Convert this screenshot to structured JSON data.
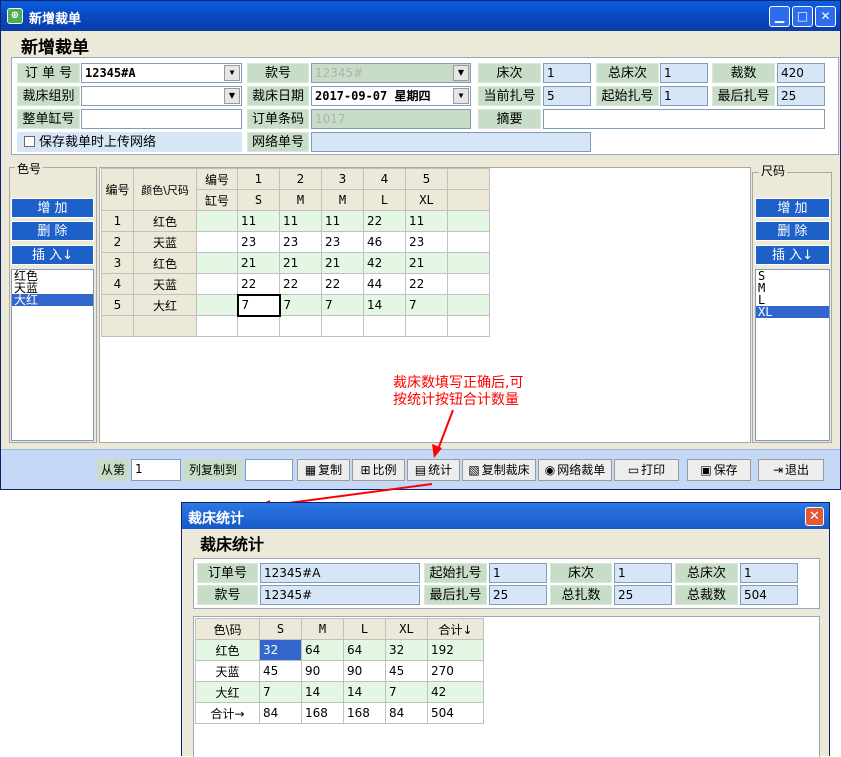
{
  "window": {
    "title": "新增裁单",
    "heading": "新增裁单"
  },
  "form": {
    "order_no_label": "订 单 号",
    "order_no": "12345#A",
    "style_no_label": "款号",
    "style_no": "12345#",
    "bed_no_label": "床次",
    "bed_no": "1",
    "total_bed_label": "总床次",
    "total_bed": "1",
    "cut_qty_label": "裁数",
    "cut_qty": "420",
    "cut_group_label": "裁床组别",
    "cut_group": "",
    "cut_date_label": "裁床日期",
    "cut_date": "2017-09-07 星期四",
    "cur_bundle_label": "当前扎号",
    "cur_bundle": "5",
    "start_bundle_label": "起始扎号",
    "start_bundle": "1",
    "last_bundle_label": "最后扎号",
    "last_bundle": "25",
    "whole_vat_label": "整单缸号",
    "whole_vat": "",
    "barcode_label": "订单条码",
    "barcode": "1017",
    "summary_label": "摘要",
    "summary": "",
    "upload_checkbox_label": "保存裁单时上传网络",
    "net_no_label": "网络单号",
    "net_no": ""
  },
  "color_group": {
    "title": "色号",
    "add": "增 加",
    "delete": "删 除",
    "insert": "插 入↓",
    "items": [
      {
        "label": "红色"
      },
      {
        "label": "天蓝"
      },
      {
        "label": "大红"
      }
    ]
  },
  "size_group": {
    "title": "尺码",
    "add": "增 加",
    "delete": "删 除",
    "insert": "插 入↓",
    "items": [
      {
        "label": "S"
      },
      {
        "label": "M"
      },
      {
        "label": "L"
      },
      {
        "label": "XL"
      }
    ]
  },
  "grid": {
    "h_no": "编号",
    "h_colorsize": "颜色\\尺码",
    "h_no2": "编号",
    "h_vat": "缸号",
    "size_nums": [
      "1",
      "2",
      "3",
      "4",
      "5"
    ],
    "sizes": [
      "S",
      "M",
      "M",
      "L",
      "XL"
    ],
    "rows": [
      {
        "no": "1",
        "color": "红色",
        "vals": [
          "11",
          "11",
          "11",
          "22",
          "11"
        ]
      },
      {
        "no": "2",
        "color": "天蓝",
        "vals": [
          "23",
          "23",
          "23",
          "46",
          "23"
        ]
      },
      {
        "no": "3",
        "color": "红色",
        "vals": [
          "21",
          "21",
          "21",
          "42",
          "21"
        ]
      },
      {
        "no": "4",
        "color": "天蓝",
        "vals": [
          "22",
          "22",
          "22",
          "44",
          "22"
        ]
      },
      {
        "no": "5",
        "color": "大红",
        "vals": [
          "7",
          "7",
          "7",
          "14",
          "7"
        ]
      }
    ]
  },
  "annotation": "裁床数填写正确后,可\n按统计按钮合计数量",
  "toolbar": {
    "from_label": "从第",
    "from_value": "1",
    "copy_col_label": "列复制到",
    "copy_col_value": "",
    "copy": "复制",
    "ratio": "比例",
    "stats": "统计",
    "copy_bed": "复制裁床",
    "net_cut": "网络裁单",
    "print": "打印",
    "save": "保存",
    "exit": "退出"
  },
  "stats_window": {
    "title": "裁床统计",
    "heading": "裁床统计",
    "order_no_label": "订单号",
    "order_no": "12345#A",
    "start_bundle_label": "起始扎号",
    "start_bundle": "1",
    "bed_label": "床次",
    "bed": "1",
    "total_bed_label": "总床次",
    "total_bed": "1",
    "style_label": "款号",
    "style": "12345#",
    "last_bundle_label": "最后扎号",
    "last_bundle": "25",
    "total_bundle_label": "总扎数",
    "total_bundle": "25",
    "total_cut_label": "总裁数",
    "total_cut": "504",
    "table_header": [
      "色\\码",
      "S",
      "M",
      "L",
      "XL",
      "合计↓"
    ],
    "rows": [
      {
        "label": "红色",
        "vals": [
          "32",
          "64",
          "64",
          "32",
          "192"
        ]
      },
      {
        "label": "天蓝",
        "vals": [
          "45",
          "90",
          "90",
          "45",
          "270"
        ]
      },
      {
        "label": "大红",
        "vals": [
          "7",
          "14",
          "14",
          "7",
          "42"
        ]
      },
      {
        "label": "合计→",
        "vals": [
          "84",
          "168",
          "168",
          "84",
          "504"
        ]
      }
    ]
  },
  "colors": {
    "title_blue": "#0848c0",
    "label_green": "#c7ddc7",
    "field_blue": "#d6e6f7",
    "note_red": "#ff0000",
    "selection": "#3366cc"
  }
}
